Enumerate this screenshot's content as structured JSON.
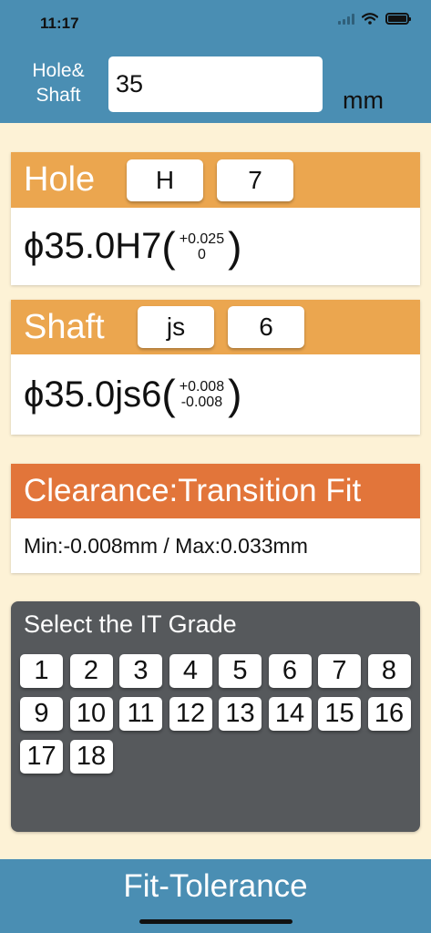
{
  "status": {
    "time": "11:17"
  },
  "header": {
    "hole_shaft_label": "Hole&\nShaft",
    "size_value": "35",
    "unit": "mm"
  },
  "hole": {
    "title": "Hole",
    "letter": "H",
    "grade": "7",
    "designation": "ϕ35.0H7",
    "upper_dev": "+0.025",
    "lower_dev": "0"
  },
  "shaft": {
    "title": "Shaft",
    "letter": "js",
    "grade": "6",
    "designation": "ϕ35.0js6",
    "upper_dev": "+0.008",
    "lower_dev": "-0.008"
  },
  "fit": {
    "title": "Clearance:Transition Fit",
    "range": "Min:-0.008mm / Max:0.033mm"
  },
  "grades": {
    "title": "Select the IT Grade",
    "items": [
      "1",
      "2",
      "3",
      "4",
      "5",
      "6",
      "7",
      "8",
      "9",
      "10",
      "11",
      "12",
      "13",
      "14",
      "15",
      "16",
      "17",
      "18"
    ]
  },
  "footer": {
    "title": "Fit-Tolerance"
  },
  "colors": {
    "header_blue": "#4a8eb3",
    "card_orange": "#eba64f",
    "fit_orange": "#e2753a",
    "panel_gray": "#56595c",
    "background_cream": "#fdf2d6"
  }
}
